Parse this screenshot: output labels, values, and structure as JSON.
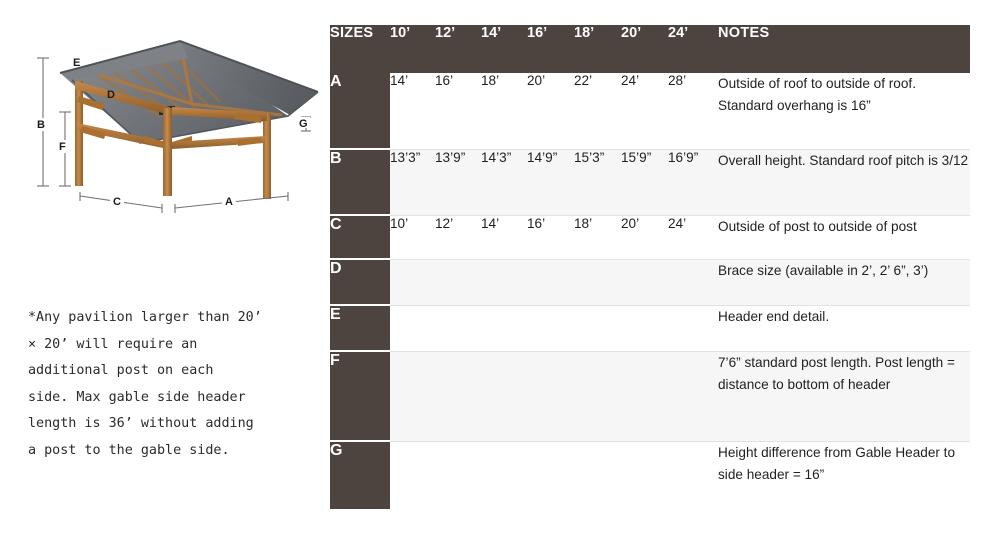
{
  "illustration": {
    "alt": "wood pavilion perspective drawing with lettered dimension callouts",
    "labels": {
      "B": "B",
      "F": "F",
      "E": "E",
      "D": "D",
      "G": "G",
      "C": "C",
      "A": "A"
    },
    "colors": {
      "wood_light": "#c08544",
      "wood_mid": "#a9702f",
      "wood_dark": "#8a5a25",
      "roof_light": "#8e9196",
      "roof_mid": "#6f7378",
      "roof_dark": "#5c6065",
      "dimension_line": "#6b5f63",
      "label_text": "#1b1b1b"
    }
  },
  "note": {
    "text": "*Any pavilion larger than 20’\n× 20’ will require an\nadditional post on each\nside. Max gable side header\nlength is 36’ without adding\na post to the gable side."
  },
  "table": {
    "header": {
      "sizes_label": "SIZES",
      "notes_label": "NOTES",
      "size_columns": [
        "10’",
        "12’",
        "14’",
        "16’",
        "18’",
        "20’",
        "24’"
      ]
    },
    "colors": {
      "header_bg": "#4d4440",
      "letter_bg": "#4d4440",
      "row_odd_bg": "#ffffff",
      "row_even_bg": "#f6f6f6",
      "text": "#231f1d",
      "header_text": "#ffffff"
    },
    "rows": [
      {
        "letter": "A",
        "values": [
          "14’",
          "16’",
          "18’",
          "20’",
          "22’",
          "24’",
          "28’"
        ],
        "notes": "Outside of roof to outside of roof. Standard overhang is 16”"
      },
      {
        "letter": "B",
        "values": [
          "13’3”",
          "13’9”",
          "14’3”",
          "14’9”",
          "15’3”",
          "15’9”",
          "16’9”"
        ],
        "notes": "Overall height. Standard roof pitch is 3/12"
      },
      {
        "letter": "C",
        "values": [
          "10’",
          "12’",
          "14’",
          "16’",
          "18’",
          "20’",
          "24’"
        ],
        "notes": "Outside of post to outside of post"
      },
      {
        "letter": "D",
        "values": [
          "",
          "",
          "",
          "",
          "",
          "",
          ""
        ],
        "notes": "Brace size (available in 2’, 2’ 6”, 3’)"
      },
      {
        "letter": "E",
        "values": [
          "",
          "",
          "",
          "",
          "",
          "",
          ""
        ],
        "notes": "Header end detail."
      },
      {
        "letter": "F",
        "values": [
          "",
          "",
          "",
          "",
          "",
          "",
          ""
        ],
        "notes": "7’6” standard post length. Post length = distance to bottom of header"
      },
      {
        "letter": "G",
        "values": [
          "",
          "",
          "",
          "",
          "",
          "",
          ""
        ],
        "notes": "Height difference from Gable Header to side header = 16”"
      }
    ]
  }
}
